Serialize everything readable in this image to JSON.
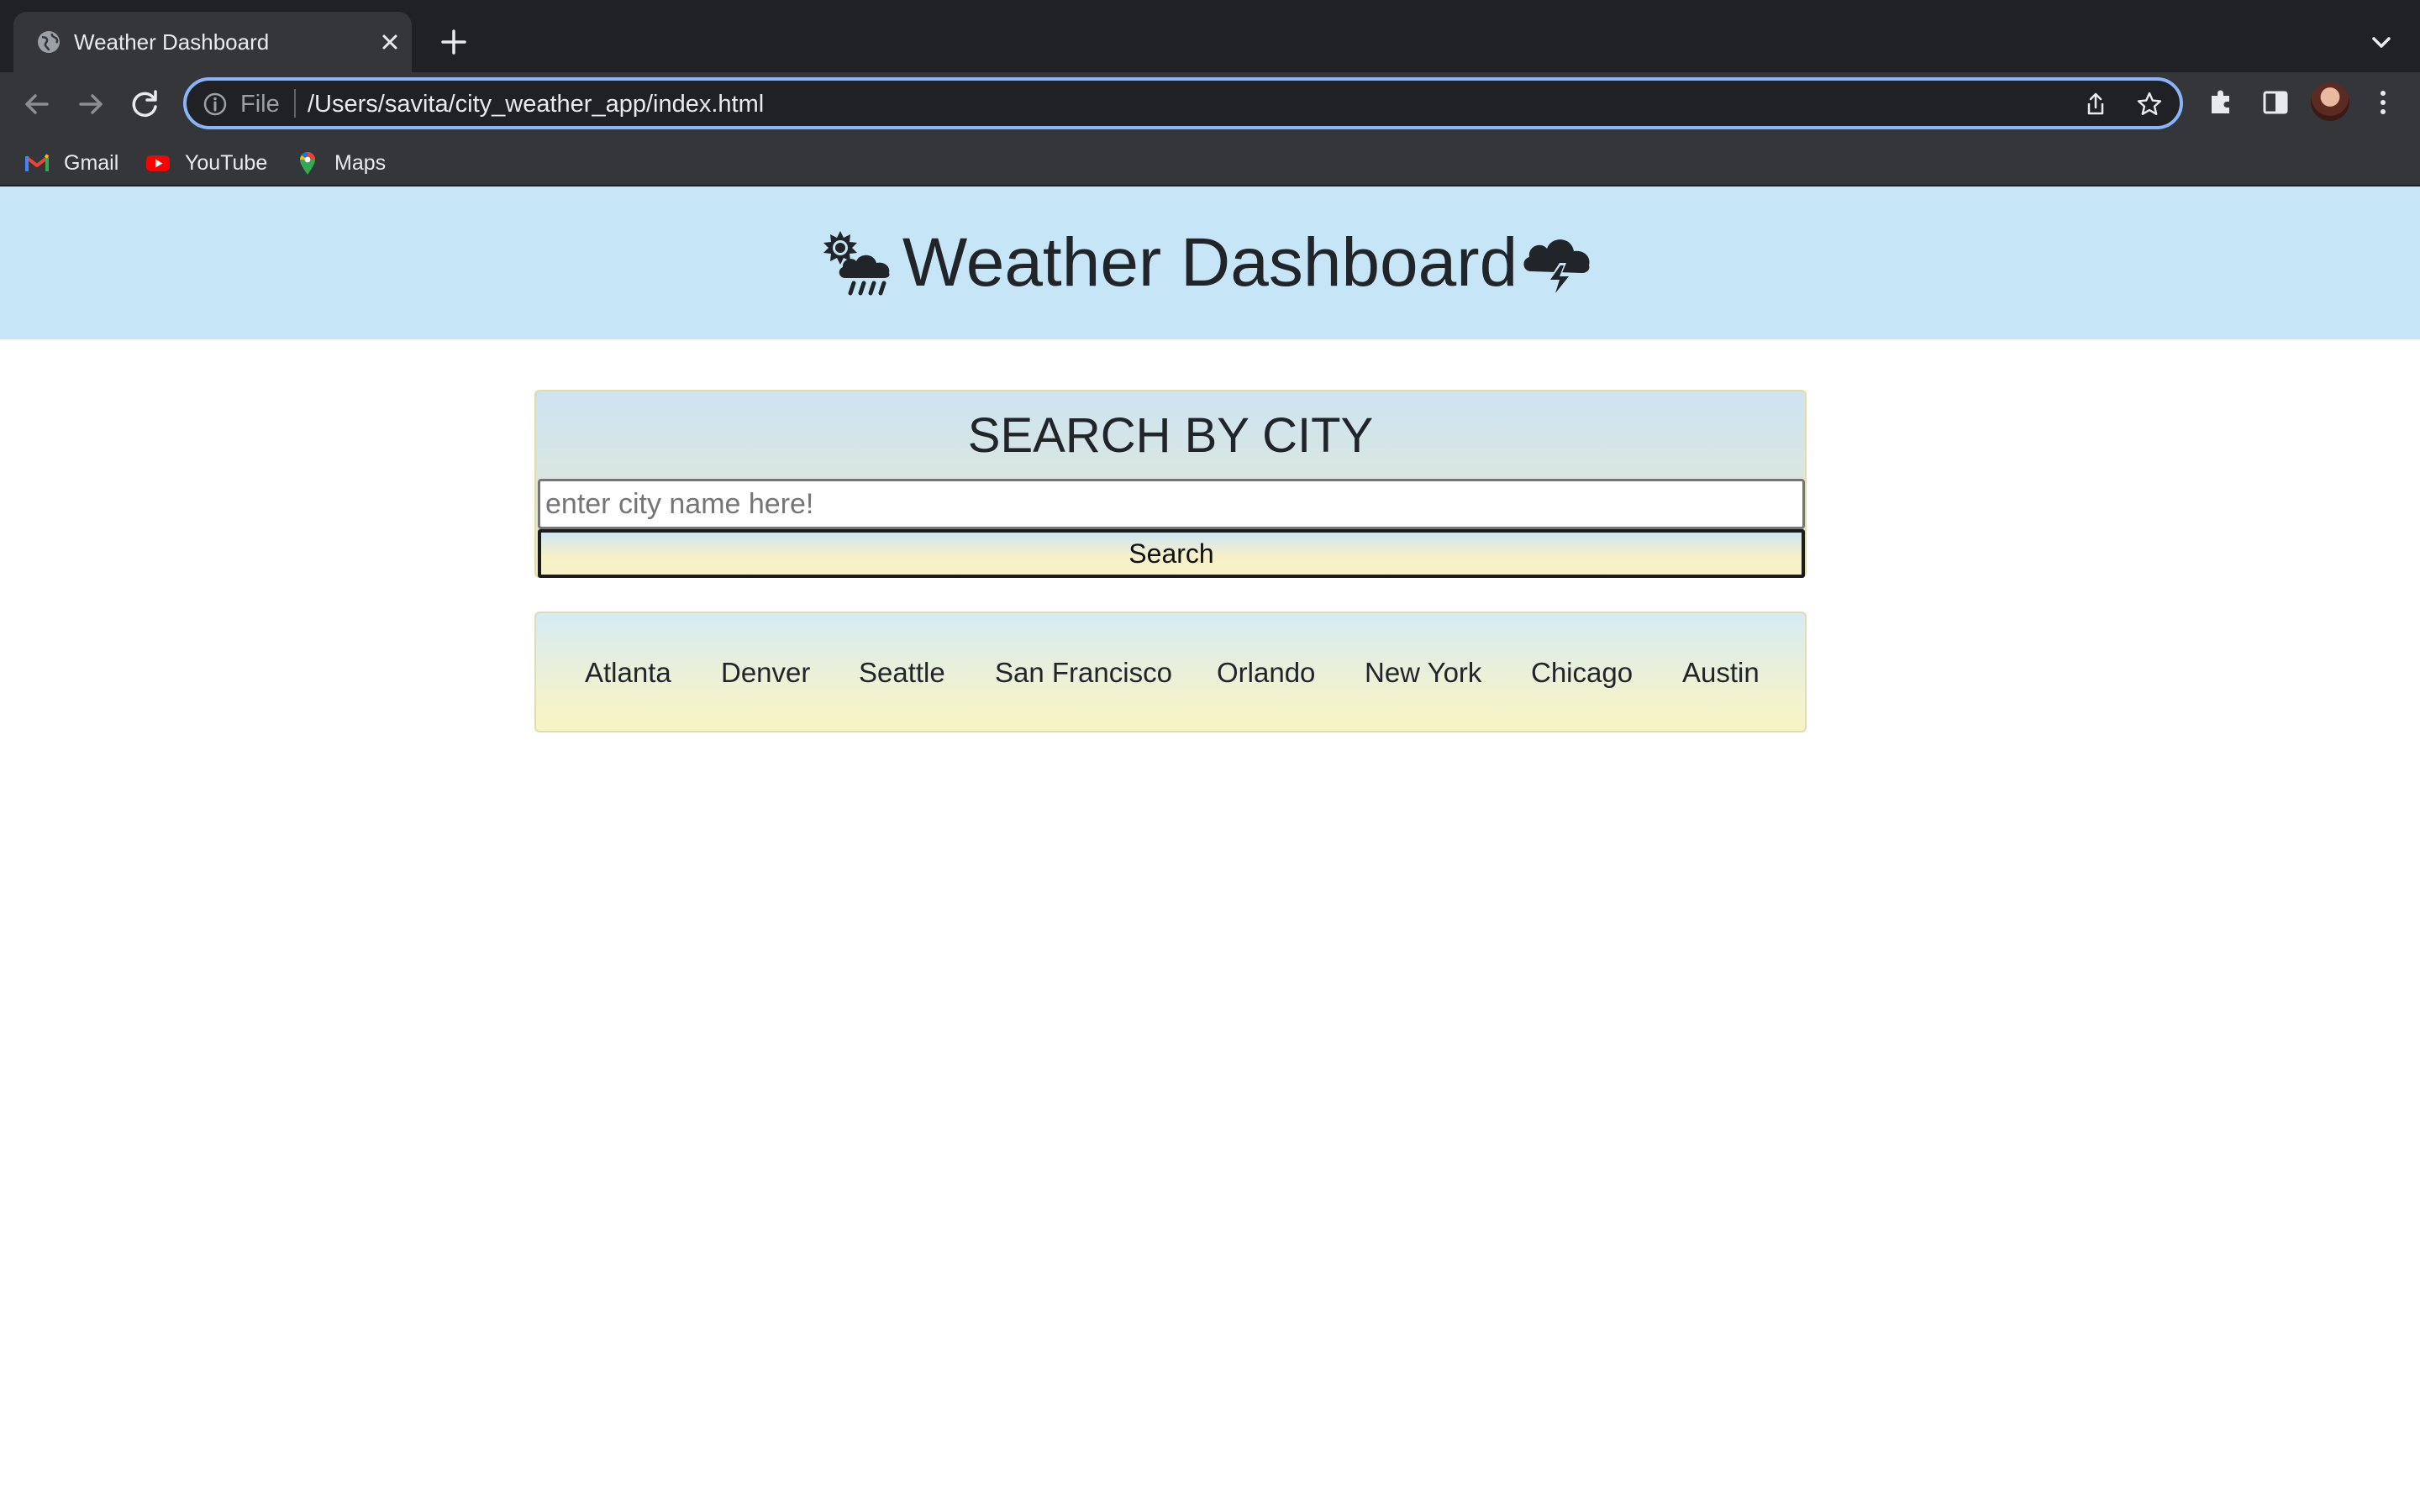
{
  "browser": {
    "tab_title": "Weather Dashboard",
    "omnibox": {
      "scheme_label": "File",
      "url": "/Users/savita/city_weather_app/index.html"
    },
    "bookmarks": [
      {
        "label": "Gmail",
        "icon": "gmail-icon"
      },
      {
        "label": "YouTube",
        "icon": "youtube-icon"
      },
      {
        "label": "Maps",
        "icon": "maps-icon"
      }
    ],
    "colors": {
      "tabbar_bg": "#202124",
      "toolbar_bg": "#35363a",
      "omnibox_focus": "#8ab4f8"
    }
  },
  "page": {
    "title": "Weather Dashboard",
    "title_icons": [
      "sun-behind-rain-cloud-icon",
      "thunder-cloud-icon"
    ],
    "search": {
      "heading": "SEARCH BY CITY",
      "input_placeholder": "enter city name here!",
      "input_value": "",
      "button_label": "Search"
    },
    "cities": [
      "Atlanta",
      "Denver",
      "Seattle",
      "San Francisco",
      "Orlando",
      "New York",
      "Chicago",
      "Austin"
    ],
    "colors": {
      "header_bg": "#c6e6f8",
      "card_gradient_top": "#cde4f2",
      "card_gradient_bottom": "#f7f3c6"
    }
  }
}
